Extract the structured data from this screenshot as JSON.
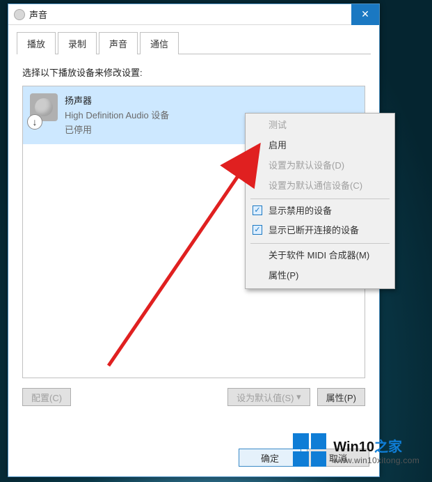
{
  "window": {
    "title": "声音"
  },
  "tabs": [
    {
      "label": "播放",
      "active": true
    },
    {
      "label": "录制",
      "active": false
    },
    {
      "label": "声音",
      "active": false
    },
    {
      "label": "通信",
      "active": false
    }
  ],
  "description": "选择以下播放设备来修改设置:",
  "device": {
    "name": "扬声器",
    "driver": "High Definition Audio 设备",
    "status": "已停用",
    "badge_glyph": "↓"
  },
  "buttons": {
    "configure": "配置(C)",
    "set_default": "设为默认值(S)",
    "properties": "属性(P)",
    "ok": "确定",
    "cancel": "取消"
  },
  "context_menu": {
    "items": [
      {
        "label": "测试",
        "disabled": true
      },
      {
        "label": "启用",
        "disabled": false
      },
      {
        "label": "设置为默认设备(D)",
        "disabled": true
      },
      {
        "label": "设置为默认通信设备(C)",
        "disabled": true
      }
    ],
    "items2": [
      {
        "label": "显示禁用的设备",
        "checked": true
      },
      {
        "label": "显示已断开连接的设备",
        "checked": true
      }
    ],
    "items3": [
      {
        "label": "关于软件 MIDI 合成器(M)"
      },
      {
        "label": "属性(P)"
      }
    ]
  },
  "watermark": {
    "brand_prefix": "Win10",
    "brand_suffix": "之家",
    "url": "www.win10xitong.com"
  }
}
